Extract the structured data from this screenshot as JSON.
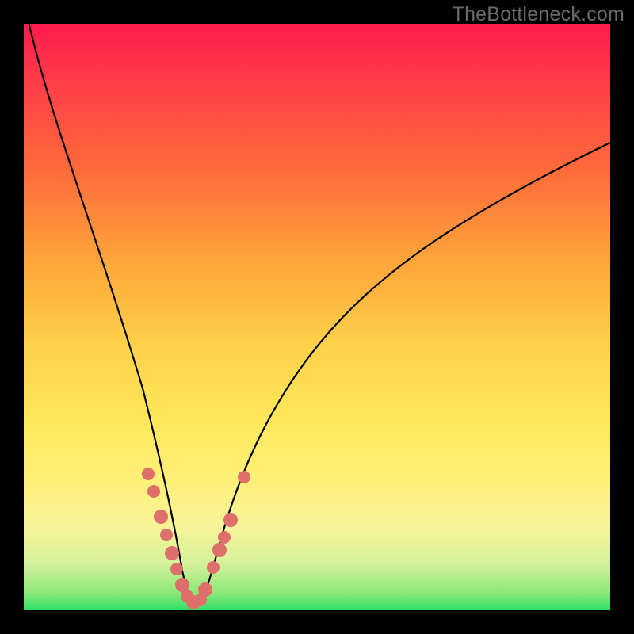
{
  "watermark": "TheBottleneck.com",
  "colors": {
    "frame": "#000000",
    "gradient_top": "#ff1a4d",
    "gradient_bottom": "#31e06a",
    "curve": "#000000",
    "dots": "#de6f6b"
  },
  "chart_data": {
    "type": "line",
    "title": "",
    "xlabel": "",
    "ylabel": "",
    "xlim": [
      0,
      100
    ],
    "ylim": [
      0,
      100
    ],
    "grid": false,
    "legend": false,
    "annotations": [
      {
        "text": "TheBottleneck.com",
        "position": "top-right"
      }
    ],
    "series": [
      {
        "name": "curve",
        "kind": "line",
        "x": [
          0,
          6,
          12,
          18,
          22,
          25,
          27,
          28.5,
          30,
          32,
          35,
          40,
          48,
          58,
          70,
          85,
          100
        ],
        "y": [
          100,
          80,
          56,
          32,
          17,
          8,
          3,
          1,
          2,
          7,
          15,
          28,
          43,
          56,
          67,
          76,
          82
        ]
      },
      {
        "name": "highlighted-points",
        "kind": "scatter",
        "x": [
          21.5,
          22.5,
          24.0,
          24.8,
          25.8,
          26.3,
          27.0,
          27.6,
          28.5,
          29.6,
          30.6,
          31.6,
          32.4,
          33.0,
          34.2,
          36.2
        ],
        "y": [
          21.0,
          17.5,
          12.8,
          10.0,
          7.0,
          5.2,
          3.4,
          2.2,
          1.6,
          2.6,
          4.4,
          6.8,
          9.0,
          10.8,
          14.6,
          22.0
        ]
      }
    ]
  }
}
